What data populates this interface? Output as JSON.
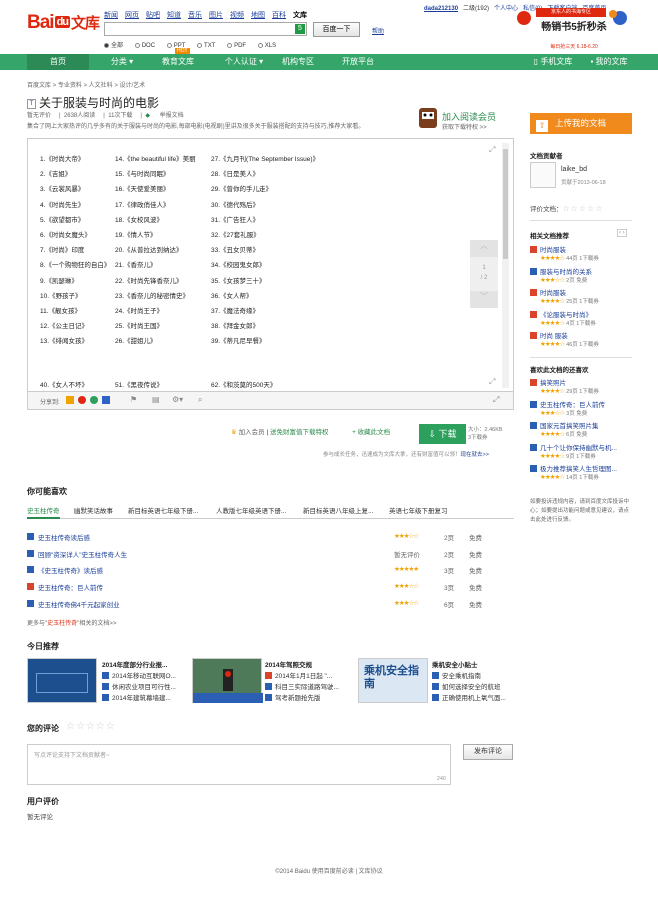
{
  "brand": {
    "logo_text": "Bai",
    "logo_du": "du",
    "logo_wenku": "文库"
  },
  "topnav": [
    "新闻",
    "网页",
    "贴吧",
    "知道",
    "音乐",
    "图片",
    "视频",
    "地图",
    "百科",
    "文库"
  ],
  "search": {
    "placeholder": "",
    "go": "5",
    "button": "百度一下",
    "help": "帮助"
  },
  "filetypes": [
    "全部",
    "DOC",
    "PPT",
    "TXT",
    "PDF",
    "XLS"
  ],
  "userbar": {
    "user": "dada212130",
    "level": "二级(192)",
    "center": "个人中心",
    "private": "私信(0)",
    "download": "下载客户端",
    "home": "百度首页"
  },
  "banner": {
    "line1": "京东人的书海专区",
    "line2": "畅销书5折秒杀",
    "line3": "每日抢三天 6.18-6.20"
  },
  "nav": {
    "items": [
      "首页",
      "分类",
      "教育文库",
      "个人认证",
      "机构专区",
      "开放平台"
    ],
    "hot": "HOT",
    "right": [
      "手机文库",
      "我的文库"
    ]
  },
  "breadcrumb": "百度文库 > 专业资料 > 人文社科 > 设计/艺术",
  "doc": {
    "title": "关于服装与时尚的电影",
    "rating": "暂无评价",
    "reads": "2638人阅读",
    "pages": "11次下载",
    "report": "举报文档",
    "desc": "集合了网上大家热评的几乎多有的关于服装与时尚的电影,每部电影(电视剧)里讲及很多关于服装搭配的支持与技巧,推荐大家看。"
  },
  "vip": {
    "title": "加入阅读会员",
    "sub": "获取下载特权 >>"
  },
  "films": [
    [
      "1.《时尚大帝》",
      "14.《the beautiful life》美丽",
      "27.《九月刊(The September Issue)》"
    ],
    [
      "2.《吉姐》",
      "15.《与时尚同眠》",
      "28.《日是美人》"
    ],
    [
      "3.《云裳风暴》",
      "16.《天使爱美丽》",
      "29.《曾你的手儿走》"
    ],
    [
      "4.《时尚先生》",
      "17.《律政俏佳人》",
      "30.《德代殇后》"
    ],
    [
      "5.《欲望都市》",
      "18.《女校风波》",
      "31.《广告狂人》"
    ],
    [
      "6.《时尚女魔头》",
      "19.《情人节》",
      "32.《27套礼服》"
    ],
    [
      "7.《时尚》印度",
      "20.《从普拉达到纳达》",
      "33.《丑女贝蒂》"
    ],
    [
      "8.《一个购物狂的自白》",
      "21.《香奈儿》",
      "34.《校园鬼女郎》"
    ],
    [
      "9.《凯瑟琳》",
      "22.《时尚先锋香奈儿》",
      "35.《女孩梦三十》"
    ],
    [
      "10.《野孩子》",
      "23.《香奈儿的秘密情史》",
      "36.《女人帮》"
    ],
    [
      "11.《靓女孩》",
      "24.《时尚王子》",
      "37.《魔法奇缘》"
    ],
    [
      "12.《公主日记》",
      "25.《时尚王国》",
      "38.《拜金女郎》"
    ],
    [
      "13.《绯闻女孩》",
      "26.《甜姐儿》",
      "39.《蒂凡尼早餐》"
    ],
    [
      "40.《女人不坏》",
      "51.《黑夜传说》",
      "62.《和茨莫的500天》"
    ]
  ],
  "viewer": {
    "page_cur": "1",
    "page_total": "/ 2",
    "share": "分享到:"
  },
  "download": {
    "join": "加入会员",
    "task": "送免财富值下载特权",
    "fav": "+ 收藏此文档",
    "btn": "下载",
    "size": "大小：2.46KB",
    "cost": "3下载券",
    "note": "参与成长任务，迅速成为文库大拿，还有财富值可以领！",
    "note_link": "现在就去>>"
  },
  "like": {
    "heading": "你可能喜欢",
    "tabs": [
      "史玉柱传奇",
      "幽默笑话故事",
      "新目标英语七年级下册...",
      "人教版七年级英语下册...",
      "新目标英语八年级上复...",
      "英语七年级下册复习"
    ],
    "rows": [
      {
        "title": "史玉柱传奇读后感",
        "type": "w",
        "stars": "★★★☆☆",
        "pages": "2页",
        "price": "免费"
      },
      {
        "title": "回顾\"资深详人\"史玉柱传奇人生",
        "type": "w",
        "stars": "暂无评价",
        "pages": "2页",
        "price": "免费"
      },
      {
        "title": "《史玉柱传奇》读后感",
        "type": "w",
        "stars": "★★★★★",
        "pages": "3页",
        "price": "免费"
      },
      {
        "title": "史玉柱传奇：巨人前传",
        "type": "p",
        "stars": "★★★☆☆",
        "pages": "3页",
        "price": "免费"
      },
      {
        "title": "史玉柱传奇佛4千元起家创业",
        "type": "w",
        "stars": "★★★☆☆",
        "pages": "6页",
        "price": "免费"
      }
    ],
    "more_pre": "更多与",
    "more_key": "史玉柱传奇",
    "more_post": "相关的文档>>"
  },
  "today": {
    "heading": "今日推荐",
    "groups": [
      {
        "head": "2014年度部分行业报...",
        "items": [
          "2014年移动互联网O...",
          "休闲农业项目可行性...",
          "2014年建筑幕墙建..."
        ]
      },
      {
        "head": "2014年驾照交规",
        "items": [
          "2014年1月1日起 \"...",
          "科目三实际道路驾驶...",
          "驾考新题抢先版"
        ]
      },
      {
        "head": "乘机安全小贴士",
        "items": [
          "安全乘机指南",
          "如何选择安全的航班",
          "正确使用机上氧气面..."
        ]
      }
    ],
    "card2_label": "乘机安全指南"
  },
  "comment": {
    "heading": "您的评论",
    "placeholder": "写点评论支持下文档贡献者~",
    "count": "240",
    "publish": "发布评论"
  },
  "user_rating": {
    "heading": "用户评价",
    "value": "暂无评论"
  },
  "footer": "©2014 Baidu 使用百度前必读 | 文库协议",
  "right": {
    "upload": "上传我的文档",
    "contrib_head": "文档贡献者",
    "contrib_name": "laike_bd",
    "contrib_date": "贡献于2013-06-18",
    "rate_label": "评价文档：",
    "related_head": "相关文档推荐",
    "related": [
      {
        "t": "时尚服装",
        "s": "★★★★☆",
        "i": "44页  1下载券"
      },
      {
        "t": "服装与时尚的关系",
        "s": "★★★☆☆",
        "i": "2页  免费"
      },
      {
        "t": "时尚服装",
        "s": "★★★★☆",
        "i": "25页  1下载券"
      },
      {
        "t": "《论服装与时尚》",
        "s": "★★★★☆",
        "i": "4页  1下载券"
      },
      {
        "t": "时尚 服装",
        "s": "★★★★☆",
        "i": "46页  1下载券"
      }
    ],
    "also_head": "喜欢此文档的还喜欢",
    "also": [
      {
        "t": "搞笑照片",
        "s": "★★★★☆",
        "i": "29页  1下载券"
      },
      {
        "t": "史玉柱传奇：巨人前传",
        "s": "★★★☆☆",
        "i": "3页  免费"
      },
      {
        "t": "国家元首搞笑照片集",
        "s": "★★★★☆",
        "i": "6页  免费"
      },
      {
        "t": "几十个让你保持幽默与机...",
        "s": "★★★★☆",
        "i": "9页  1下载券"
      },
      {
        "t": "极力推荐搞笑人生哲理图...",
        "s": "★★★★☆",
        "i": "14页  1下载券"
      }
    ],
    "notice": "如要投诉违规内容，请到百度文库投诉中心；如要提出功能问题或意见建议，请点击此处进行反馈。"
  },
  "colors": {
    "green": "#35a56a",
    "orange": "#f08a1c",
    "link": "#1a3e9a",
    "red": "#de2910"
  }
}
